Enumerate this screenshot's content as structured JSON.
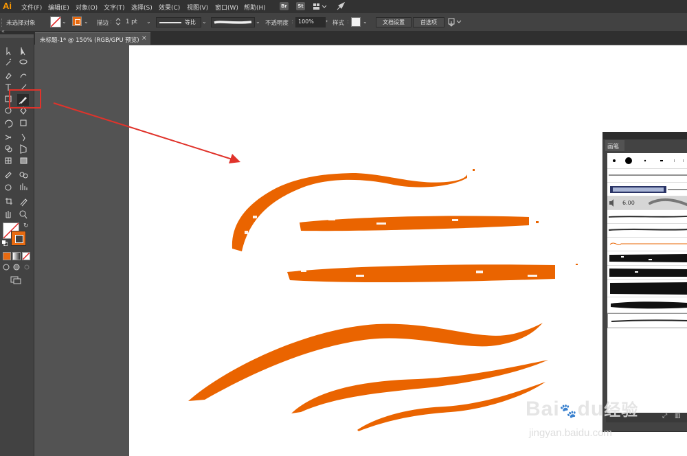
{
  "app": {
    "logo": "Ai"
  },
  "menu": [
    "文件(F)",
    "编辑(E)",
    "对象(O)",
    "文字(T)",
    "选择(S)",
    "效果(C)",
    "视图(V)",
    "窗口(W)",
    "帮助(H)"
  ],
  "app_buttons": {
    "bridge": "Br",
    "stock": "St"
  },
  "control": {
    "selection_status": "未选择对象",
    "stroke_label": "描边",
    "stroke_weight": "1 pt",
    "stroke_profile": "等比",
    "opacity_label": "不透明度",
    "opacity_value": "100%",
    "style_label": "样式",
    "doc_setup_button": "文档设置",
    "preferences_button": "首选项"
  },
  "document_tab": {
    "title": "未标题-1* @ 150% (RGB/GPU 预览)",
    "close": "×"
  },
  "brushes_panel": {
    "title": "画笔",
    "size_label": "6.00"
  },
  "watermark": {
    "brand": "Bai",
    "brand2": "du",
    "product": "经验",
    "url": "jingyan.baidu.com"
  },
  "colors": {
    "brush_stroke": "#ea6400",
    "highlight": "#e0332b",
    "fill_orange": "#e86a10",
    "logo": "#ff9a00"
  },
  "icons": [
    "selection-tool-icon",
    "direct-selection-tool-icon",
    "magic-wand-icon",
    "lasso-icon",
    "pen-tool-icon",
    "curvature-tool-icon",
    "type-tool-icon",
    "line-tool-icon",
    "rectangle-tool-icon",
    "paintbrush-tool-icon",
    "rotate-tool-icon",
    "scale-tool-icon",
    "eyedropper-icon",
    "hand-tool-icon",
    "zoom-tool-icon"
  ]
}
